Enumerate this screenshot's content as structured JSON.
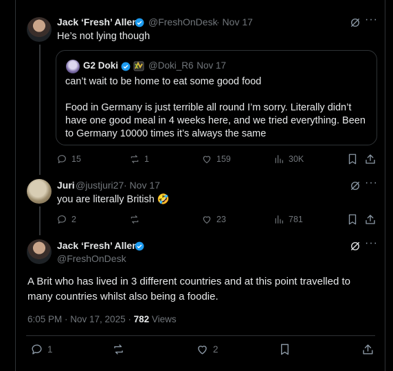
{
  "colors": {
    "background": "#000000",
    "text": "#e7e9ea",
    "muted": "#71767b",
    "verified": "#1d9bf0",
    "border": "#2f3336"
  },
  "tweet1": {
    "name": "Jack ‘Fresh’ Allen",
    "handle": "@FreshOnDesk",
    "date": "· Nov 17",
    "text": "He’s not lying though",
    "quote": {
      "name": "G2 Doki",
      "handle": "@Doki_R6",
      "date": "· Nov 17",
      "line1": "can’t wait to be home to eat some good food",
      "para": "Food in Germany is just terrible all round I’m sorry. Literally didn’t have one good meal in 4 weeks here, and we tried everything. Been to Germany 10000 times it’s always the same"
    },
    "actions": {
      "replies": "15",
      "reposts": "1",
      "likes": "159",
      "views": "30K"
    }
  },
  "tweet2": {
    "name": "Juri",
    "handle": "@justjuri27",
    "date": "· Nov 17",
    "text": "you are literally British",
    "emoji": "🤣",
    "actions": {
      "replies": "2",
      "reposts": "",
      "likes": "23",
      "views": "781"
    }
  },
  "tweet3": {
    "name": "Jack ‘Fresh’ Allen",
    "handle": "@FreshOnDesk",
    "text": "A Brit who has lived in 3 different countries and at this point travelled to many countries whilst also being a foodie.",
    "timestamp": "6:05 PM · Nov 17, 2025 ·",
    "views_count": "782",
    "views_label": "Views",
    "actions": {
      "replies": "1",
      "likes": "2"
    }
  },
  "icons": [
    "verified-badge-icon",
    "grok-icon",
    "more-icon",
    "reply-icon",
    "repost-icon",
    "like-icon",
    "views-icon",
    "bookmark-icon",
    "share-icon"
  ]
}
